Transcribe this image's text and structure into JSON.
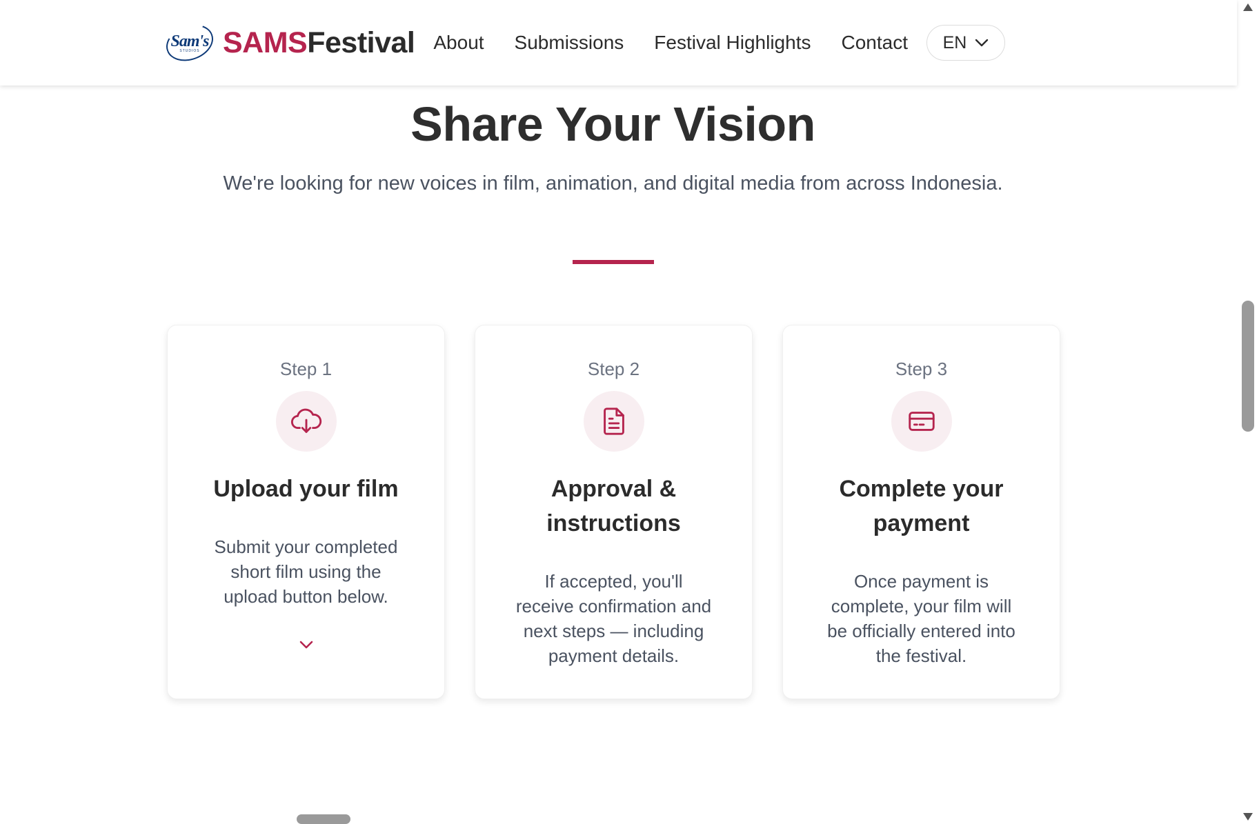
{
  "header": {
    "logo_text": "Sam's",
    "logo_subtext": "STUDIOS",
    "brand_part1": "SAMS",
    "brand_part2": "Festival",
    "nav": [
      {
        "label": "About"
      },
      {
        "label": "Submissions"
      },
      {
        "label": "Festival Highlights"
      },
      {
        "label": "Contact"
      }
    ],
    "language": "EN"
  },
  "hero": {
    "title": "Share Your Vision",
    "subtitle": "We're looking for new voices in film, animation, and digital media from across Indonesia."
  },
  "steps": [
    {
      "step_label": "Step 1",
      "icon": "cloud-download-icon",
      "title": "Upload your film",
      "description": "Submit your completed short film using the upload button below."
    },
    {
      "step_label": "Step 2",
      "icon": "document-icon",
      "title": "Approval & instructions",
      "description": "If accepted, you'll receive confirmation and next steps — including payment details."
    },
    {
      "step_label": "Step 3",
      "icon": "credit-card-icon",
      "title": "Complete your payment",
      "description": "Once payment is complete, your film will be officially entered into the festival."
    }
  ],
  "colors": {
    "accent": "#b5244e",
    "brand_mid": "#8e4a6a",
    "logo_blue": "#0e3a78",
    "icon_bg": "#f8eef1"
  }
}
